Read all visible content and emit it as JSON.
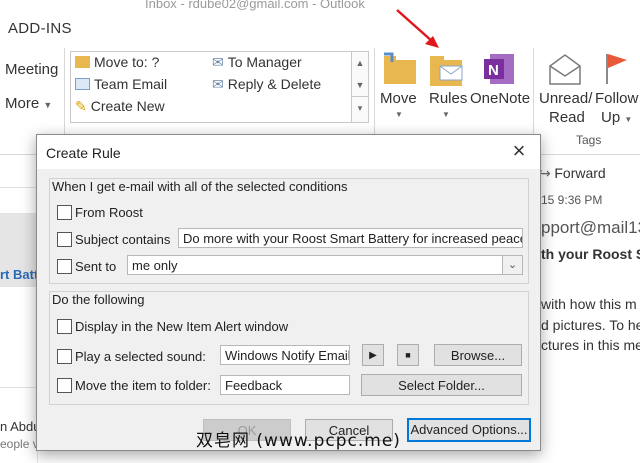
{
  "window": {
    "title": "Inbox - rdube02@gmail.com - Outlook"
  },
  "ribbon_tab": "ADD-INS",
  "ribbon": {
    "meeting": "Meeting",
    "more": "More",
    "quick_steps": [
      "Move to: ?",
      "Team Email",
      "Create New",
      "To Manager",
      "Reply & Delete"
    ],
    "move": "Move",
    "rules": "Rules",
    "onenote": "OneNote",
    "unread": "Unread/",
    "read": "Read",
    "follow": "Follow",
    "up": "Up",
    "tags_label": "Tags"
  },
  "background": {
    "forward": "Forward",
    "time": "15 9:36 PM",
    "sender": "pport@mail13",
    "subject": "th your Roost S",
    "left_snippet": "rt Batt",
    "body_lines": [
      "with how this m",
      "d pictures. To he",
      "ctures in this me"
    ],
    "bottom_left_1": "n Abdu",
    "bottom_left_2": "eople v"
  },
  "dialog": {
    "title": "Create Rule",
    "conditions_header": "When I get e-mail with all of the selected conditions",
    "from_label": "From Roost",
    "subject_label": "Subject contains",
    "subject_value": "Do more with your Roost Smart Battery for increased peace of",
    "sent_to_label": "Sent to",
    "sent_to_value": "me only",
    "actions_header": "Do the following",
    "display_alert_label": "Display in the New Item Alert window",
    "play_sound_label": "Play a selected sound:",
    "sound_value": "Windows Notify Email.",
    "browse_button": "Browse...",
    "move_folder_label": "Move the item to folder:",
    "folder_value": "Feedback",
    "select_folder_button": "Select Folder...",
    "ok_button": "OK",
    "cancel_button": "Cancel",
    "advanced_button": "Advanced Options..."
  },
  "watermark": "双皂网 (www.pcpc.me)",
  "colors": {
    "accent": "#0078d7",
    "arrow": "#e0181e",
    "flag": "#e8593a",
    "onenote": "#7b2f9e",
    "folder": "#e9b74f"
  }
}
